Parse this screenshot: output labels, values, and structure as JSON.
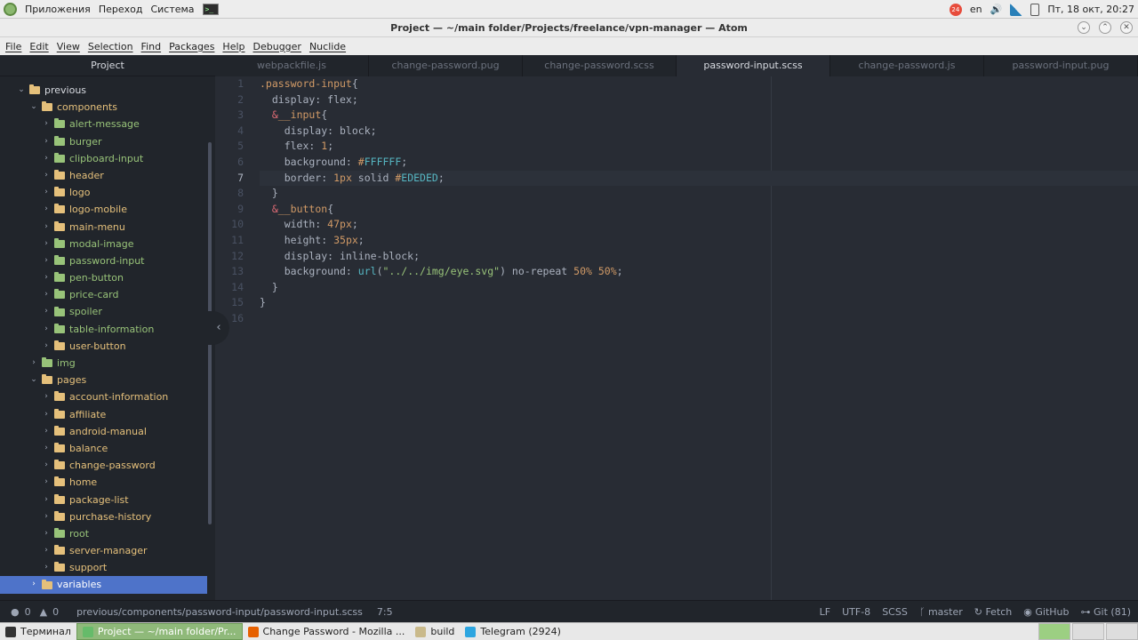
{
  "system_panel": {
    "menu": [
      "Приложения",
      "Переход",
      "Система"
    ],
    "tray": {
      "badge": "24",
      "lang": "en",
      "datetime": "Пт, 18 окт, 20:27"
    }
  },
  "window": {
    "title": "Project — ~/main folder/Projects/freelance/vpn-manager — Atom",
    "buttons": [
      "⌄",
      "⌃",
      "✕"
    ]
  },
  "menubar": [
    "File",
    "Edit",
    "View",
    "Selection",
    "Find",
    "Packages",
    "Help",
    "Debugger",
    "Nuclide"
  ],
  "tree": {
    "header": "Project",
    "rows": [
      {
        "label": "previous",
        "depth": 0,
        "open": true,
        "color": "#e5c07b",
        "text_color": "#d7dae0"
      },
      {
        "label": "components",
        "depth": 1,
        "open": true,
        "color": "#e5c07b",
        "text_color": "#e5c07b"
      },
      {
        "label": "alert-message",
        "depth": 2,
        "open": false,
        "color": "#98c379",
        "text_color": "#98c379"
      },
      {
        "label": "burger",
        "depth": 2,
        "open": false,
        "color": "#98c379",
        "text_color": "#98c379"
      },
      {
        "label": "clipboard-input",
        "depth": 2,
        "open": false,
        "color": "#98c379",
        "text_color": "#98c379"
      },
      {
        "label": "header",
        "depth": 2,
        "open": false,
        "color": "#e5c07b",
        "text_color": "#e5c07b"
      },
      {
        "label": "logo",
        "depth": 2,
        "open": false,
        "color": "#e5c07b",
        "text_color": "#e5c07b"
      },
      {
        "label": "logo-mobile",
        "depth": 2,
        "open": false,
        "color": "#e5c07b",
        "text_color": "#e5c07b"
      },
      {
        "label": "main-menu",
        "depth": 2,
        "open": false,
        "color": "#e5c07b",
        "text_color": "#e5c07b"
      },
      {
        "label": "modal-image",
        "depth": 2,
        "open": false,
        "color": "#98c379",
        "text_color": "#98c379"
      },
      {
        "label": "password-input",
        "depth": 2,
        "open": false,
        "color": "#98c379",
        "text_color": "#98c379"
      },
      {
        "label": "pen-button",
        "depth": 2,
        "open": false,
        "color": "#98c379",
        "text_color": "#98c379"
      },
      {
        "label": "price-card",
        "depth": 2,
        "open": false,
        "color": "#98c379",
        "text_color": "#98c379"
      },
      {
        "label": "spoiler",
        "depth": 2,
        "open": false,
        "color": "#98c379",
        "text_color": "#98c379"
      },
      {
        "label": "table-information",
        "depth": 2,
        "open": false,
        "color": "#98c379",
        "text_color": "#98c379"
      },
      {
        "label": "user-button",
        "depth": 2,
        "open": false,
        "color": "#e5c07b",
        "text_color": "#e5c07b"
      },
      {
        "label": "img",
        "depth": 1,
        "open": false,
        "color": "#98c379",
        "text_color": "#98c379"
      },
      {
        "label": "pages",
        "depth": 1,
        "open": true,
        "color": "#e5c07b",
        "text_color": "#e5c07b"
      },
      {
        "label": "account-information",
        "depth": 2,
        "open": false,
        "color": "#e5c07b",
        "text_color": "#e5c07b"
      },
      {
        "label": "affiliate",
        "depth": 2,
        "open": false,
        "color": "#e5c07b",
        "text_color": "#e5c07b"
      },
      {
        "label": "android-manual",
        "depth": 2,
        "open": false,
        "color": "#e5c07b",
        "text_color": "#e5c07b"
      },
      {
        "label": "balance",
        "depth": 2,
        "open": false,
        "color": "#e5c07b",
        "text_color": "#e5c07b"
      },
      {
        "label": "change-password",
        "depth": 2,
        "open": false,
        "color": "#e5c07b",
        "text_color": "#e5c07b"
      },
      {
        "label": "home",
        "depth": 2,
        "open": false,
        "color": "#e5c07b",
        "text_color": "#e5c07b"
      },
      {
        "label": "package-list",
        "depth": 2,
        "open": false,
        "color": "#e5c07b",
        "text_color": "#e5c07b"
      },
      {
        "label": "purchase-history",
        "depth": 2,
        "open": false,
        "color": "#e5c07b",
        "text_color": "#e5c07b"
      },
      {
        "label": "root",
        "depth": 2,
        "open": false,
        "color": "#98c379",
        "text_color": "#98c379"
      },
      {
        "label": "server-manager",
        "depth": 2,
        "open": false,
        "color": "#e5c07b",
        "text_color": "#e5c07b"
      },
      {
        "label": "support",
        "depth": 2,
        "open": false,
        "color": "#e5c07b",
        "text_color": "#e5c07b"
      },
      {
        "label": "variables",
        "depth": 1,
        "open": false,
        "color": "#e5c07b",
        "text_color": "#ffffff",
        "selected": true
      }
    ]
  },
  "tabs": [
    {
      "label": "webpackfile.js",
      "active": false
    },
    {
      "label": "change-password.pug",
      "active": false
    },
    {
      "label": "change-password.scss",
      "active": false
    },
    {
      "label": "password-input.scss",
      "active": true
    },
    {
      "label": "change-password.js",
      "active": false
    },
    {
      "label": "password-input.pug",
      "active": false
    }
  ],
  "editor": {
    "current_line": 7,
    "lines": [
      [
        {
          "t": ".password-input",
          "c": "sel"
        },
        {
          "t": "{",
          "c": "val"
        }
      ],
      [
        {
          "t": "  display: flex;",
          "c": "val"
        }
      ],
      [
        {
          "t": "  ",
          "c": "val"
        },
        {
          "t": "&",
          "c": "amp"
        },
        {
          "t": "__input",
          "c": "sel"
        },
        {
          "t": "{",
          "c": "val"
        }
      ],
      [
        {
          "t": "    display: block;",
          "c": "val"
        }
      ],
      [
        {
          "t": "    flex: ",
          "c": "val"
        },
        {
          "t": "1",
          "c": "num"
        },
        {
          "t": ";",
          "c": "val"
        }
      ],
      [
        {
          "t": "    background: ",
          "c": "val"
        },
        {
          "t": "#",
          "c": "num"
        },
        {
          "t": "FFFFFF",
          "c": "hex"
        },
        {
          "t": ";",
          "c": "val"
        }
      ],
      [
        {
          "t": "    border: ",
          "c": "val"
        },
        {
          "t": "1px",
          "c": "num"
        },
        {
          "t": " solid ",
          "c": "val"
        },
        {
          "t": "#",
          "c": "num"
        },
        {
          "t": "EDEDED",
          "c": "hex"
        },
        {
          "t": ";",
          "c": "val"
        }
      ],
      [
        {
          "t": "  }",
          "c": "val"
        }
      ],
      [
        {
          "t": "  ",
          "c": "val"
        },
        {
          "t": "&",
          "c": "amp"
        },
        {
          "t": "__button",
          "c": "sel"
        },
        {
          "t": "{",
          "c": "val"
        }
      ],
      [
        {
          "t": "    width: ",
          "c": "val"
        },
        {
          "t": "47px",
          "c": "num"
        },
        {
          "t": ";",
          "c": "val"
        }
      ],
      [
        {
          "t": "    height: ",
          "c": "val"
        },
        {
          "t": "35px",
          "c": "num"
        },
        {
          "t": ";",
          "c": "val"
        }
      ],
      [
        {
          "t": "    display: inline-block;",
          "c": "val"
        }
      ],
      [
        {
          "t": "    background: ",
          "c": "val"
        },
        {
          "t": "url",
          "c": "fn"
        },
        {
          "t": "(",
          "c": "val"
        },
        {
          "t": "\"../../img/eye.svg\"",
          "c": "str"
        },
        {
          "t": ") no-repeat ",
          "c": "val"
        },
        {
          "t": "50%",
          "c": "num"
        },
        {
          "t": " ",
          "c": "val"
        },
        {
          "t": "50%",
          "c": "num"
        },
        {
          "t": ";",
          "c": "val"
        }
      ],
      [
        {
          "t": "  }",
          "c": "val"
        }
      ],
      [
        {
          "t": "}",
          "c": "val"
        }
      ],
      []
    ]
  },
  "status": {
    "errors": "0",
    "warnings": "0",
    "path": "previous/components/password-input/password-input.scss",
    "cursor": "7:5",
    "line_ending": "LF",
    "encoding": "UTF-8",
    "grammar": "SCSS",
    "branch": "master",
    "fetch": "Fetch",
    "github": "GitHub",
    "git": "Git (81)"
  },
  "taskbar": [
    {
      "label": "Терминал",
      "active": false,
      "icon_color": "#333333"
    },
    {
      "label": "Project — ~/main folder/Pr...",
      "active": true,
      "icon_color": "#66bb6a"
    },
    {
      "label": "Change Password - Mozilla ...",
      "active": false,
      "icon_color": "#e66000"
    },
    {
      "label": "build",
      "active": false,
      "icon_color": "#c9b98a"
    },
    {
      "label": "Telegram (2924)",
      "active": false,
      "icon_color": "#2ca5e0"
    }
  ]
}
